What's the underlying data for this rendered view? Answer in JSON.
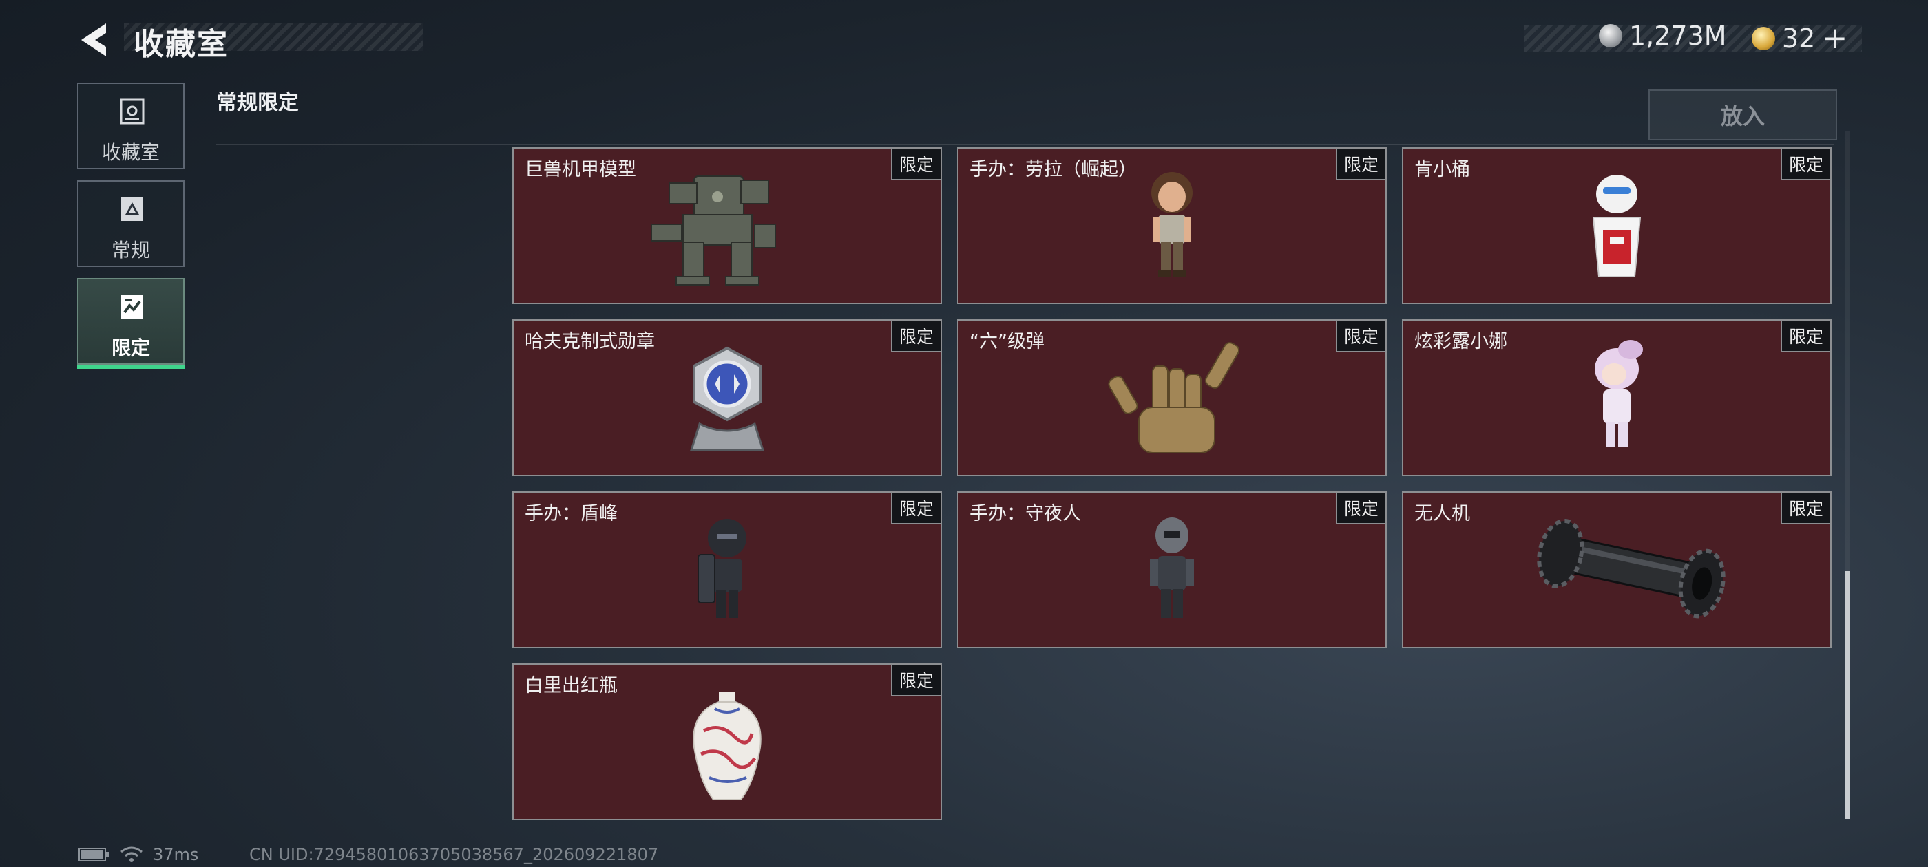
{
  "header": {
    "title": "收藏室",
    "currency_silver": "1,273M",
    "currency_gold": "32",
    "add_symbol": "+"
  },
  "sidebar": {
    "tabs": [
      {
        "label": "收藏室",
        "icon": "vault-icon"
      },
      {
        "label": "常规",
        "icon": "regular-icon"
      },
      {
        "label": "限定",
        "icon": "limited-icon",
        "active": true
      }
    ]
  },
  "section": {
    "title": "常规限定",
    "put_button": "放入"
  },
  "items": [
    {
      "name": "巨兽机甲模型",
      "badge": "限定",
      "icon": "mech-model-icon"
    },
    {
      "name": "手办：劳拉（崛起）",
      "badge": "限定",
      "icon": "lara-figure-icon"
    },
    {
      "name": "肯小桶",
      "badge": "限定",
      "icon": "kfc-bucket-figure-icon"
    },
    {
      "name": "哈夫克制式勋章",
      "badge": "限定",
      "icon": "haavk-medal-icon"
    },
    {
      "name": "“六”级弹",
      "badge": "限定",
      "icon": "six-bullets-hand-icon"
    },
    {
      "name": "炫彩露小娜",
      "badge": "限定",
      "icon": "luna-figure-icon"
    },
    {
      "name": "手办：盾峰",
      "badge": "限定",
      "icon": "shield-figure-icon"
    },
    {
      "name": "手办：守夜人",
      "badge": "限定",
      "icon": "nightwatch-figure-icon"
    },
    {
      "name": "无人机",
      "badge": "限定",
      "icon": "drone-icon"
    },
    {
      "name": "白里出红瓶",
      "badge": "限定",
      "icon": "porcelain-vase-icon"
    }
  ],
  "status": {
    "ping": "37ms",
    "uid": "CN UID:7294580106370503856​7_202609221807"
  }
}
